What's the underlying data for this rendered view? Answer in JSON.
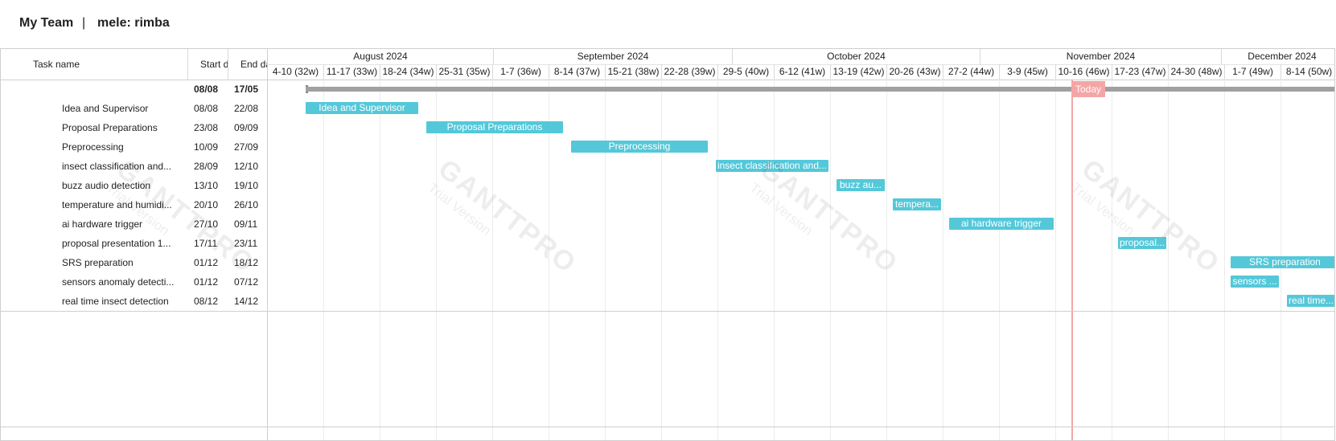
{
  "header": {
    "team": "My Team",
    "separator": "|",
    "project": "mele: rimba"
  },
  "columns": {
    "task": "Task name",
    "start": "Start d",
    "end": "End da"
  },
  "summary": {
    "start": "08/08",
    "end": "17/05"
  },
  "tasks": [
    {
      "name": "Idea and Supervisor",
      "start": "08/08",
      "end": "22/08",
      "bar_label": "Idea and Supervisor"
    },
    {
      "name": "Proposal Preparations",
      "start": "23/08",
      "end": "09/09",
      "bar_label": "Proposal Preparations"
    },
    {
      "name": "Preprocessing",
      "start": "10/09",
      "end": "27/09",
      "bar_label": "Preprocessing"
    },
    {
      "name": "insect classification and...",
      "start": "28/09",
      "end": "12/10",
      "bar_label": "insect classification and..."
    },
    {
      "name": "buzz audio detection",
      "start": "13/10",
      "end": "19/10",
      "bar_label": "buzz au..."
    },
    {
      "name": "temperature and humidi...",
      "start": "20/10",
      "end": "26/10",
      "bar_label": "tempera..."
    },
    {
      "name": "ai hardware trigger",
      "start": "27/10",
      "end": "09/11",
      "bar_label": "ai hardware trigger"
    },
    {
      "name": "proposal presentation 1...",
      "start": "17/11",
      "end": "23/11",
      "bar_label": "proposal..."
    },
    {
      "name": "SRS preparation",
      "start": "01/12",
      "end": "18/12",
      "bar_label": "SRS preparation"
    },
    {
      "name": "sensors anomaly detecti...",
      "start": "01/12",
      "end": "07/12",
      "bar_label": "sensors ..."
    },
    {
      "name": "real time insect detection",
      "start": "08/12",
      "end": "14/12",
      "bar_label": "real time..."
    }
  ],
  "timeline": {
    "months": [
      "August 2024",
      "September 2024",
      "October 2024",
      "November 2024",
      "December 2024"
    ],
    "weeks": [
      "4-10 (32w)",
      "11-17 (33w)",
      "18-24 (34w)",
      "25-31 (35w)",
      "1-7 (36w)",
      "8-14 (37w)",
      "15-21 (38w)",
      "22-28 (39w)",
      "29-5 (40w)",
      "6-12 (41w)",
      "13-19 (42w)",
      "20-26 (43w)",
      "27-2 (44w)",
      "3-9 (45w)",
      "10-16 (46w)",
      "17-23 (47w)",
      "24-30 (48w)",
      "1-7 (49w)",
      "8-14 (50w)"
    ],
    "today_label": "Today"
  },
  "watermark": {
    "brand": "GANTTPRO",
    "note": "Trial Version"
  },
  "colors": {
    "bar": "#54c8d9",
    "summary": "#a0a0a0",
    "today": "#f4a7a7"
  }
}
